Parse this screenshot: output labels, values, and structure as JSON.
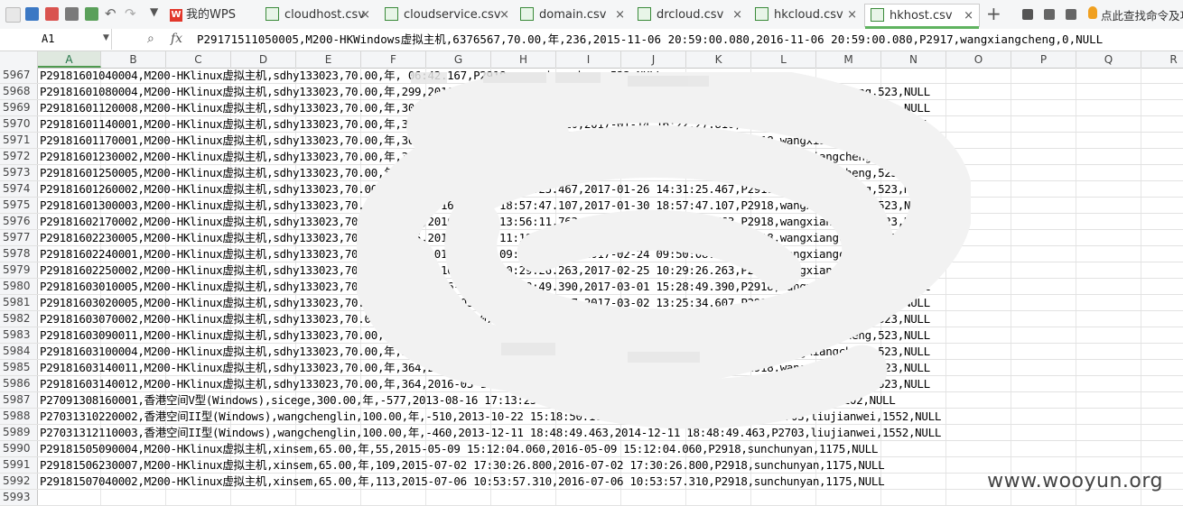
{
  "tabs": [
    {
      "label": "我的WPS",
      "kind": "wps"
    },
    {
      "label": "cloudhost.csv",
      "kind": "csv"
    },
    {
      "label": "cloudservice.csv",
      "kind": "csv"
    },
    {
      "label": "domain.csv",
      "kind": "csv"
    },
    {
      "label": "drcloud.csv",
      "kind": "csv"
    },
    {
      "label": "hkcloud.csv",
      "kind": "csv"
    },
    {
      "label": "hkhost.csv",
      "kind": "csv",
      "active": true
    }
  ],
  "toolbar": {
    "new_tab": "+",
    "search_hint": "点此查找命令及功"
  },
  "formula_bar": {
    "cell_ref": "A1",
    "fx": "fx",
    "value": "P29171511050005,M200-HKWindows虚拟主机,6376567,70.00,年,236,2015-11-06 20:59:00.080,2016-11-06 20:59:00.080,P2917,wangxiangcheng,0,NULL"
  },
  "columns": [
    "A",
    "B",
    "C",
    "D",
    "E",
    "F",
    "G",
    "H",
    "I",
    "J",
    "K",
    "L",
    "M",
    "N",
    "O",
    "P",
    "Q",
    "R"
  ],
  "rows": [
    {
      "num": "5967",
      "text": "P29181601040004,M200-HKlinux虚拟主机,sdhy133023,70.00,年,                           06:42.167,P2918,wangxiangcheng,523,NULL"
    },
    {
      "num": "5968",
      "text": "P29181601080004,M200-HKlinux虚拟主机,sdhy133023,70.00,年,299,2016-01-08 17:20:18.780,2017-01-08 17:20:18.780,P2918,wangxiangcheng,523,NULL"
    },
    {
      "num": "5969",
      "text": "P29181601120008,M200-HKlinux虚拟主机,sdhy133023,70.00,年,303,2016-01-12 14:31:39.123,2017-01-12 14:31:39.123,P2918,wangxiangcheng,523,NULL"
    },
    {
      "num": "5970",
      "text": "P29181601140001,M200-HKlinux虚拟主机,sdhy133023,70.00,年,305,2016-01-14 16:22:27.810,2017-01-14 16:22:27.810,P2918,wangxiangcheng,523,NULL"
    },
    {
      "num": "5971",
      "text": "P29181601170001,M200-HKlinux虚拟主机,sdhy133023,70.00,年,308,2016-01-17 10:35:12.513,2017-01-17 10:35:12.513,P2918,wangxiangcheng,523,NULL"
    },
    {
      "num": "5972",
      "text": "P29181601230002,M200-HKlinux虚拟主机,sdhy133023,70.00,年,314,2016-01-23 12:03:55.403,2017-01-23 12:03:55.403,P2918,wangxiangcheng,523,NULL"
    },
    {
      "num": "5973",
      "text": "P29181601250005,M200-HKlinux虚拟主机,sdhy133023,70.00,年,316,2016-01-25 11:38:02.110,2017-01-25 11:38:02.110,P2918,wangxiangcheng,523,NULL"
    },
    {
      "num": "5974",
      "text": "P29181601260002,M200-HKlinux虚拟主机,sdhy133023,70.00,年,317,2016-01-26 14:31:25.467,2017-01-26 14:31:25.467,P2918,wangxiangcheng,523,NULL"
    },
    {
      "num": "5975",
      "text": "P29181601300003,M200-HKlinux虚拟主机,sdhy133023,70.00,年,321,2016-01-30 18:57:47.107,2017-01-30 18:57:47.107,P2918,wangxiangcheng,523,NULL"
    },
    {
      "num": "5976",
      "text": "P29181602170002,M200-HKlinux虚拟主机,sdhy133023,70.00,年,339,2016-02-17 13:56:11.763,2017-02-17 13:56:11.763,P2918,wangxiangcheng,523,NULL"
    },
    {
      "num": "5977",
      "text": "P29181602230005,M200-HKlinux虚拟主机,sdhy133023,70.00,年,345,2016-02-23 11:19:37.513,2017-02-23 11:19:37.513,P2918,wangxiangcheng,523,NULL"
    },
    {
      "num": "5978",
      "text": "P29181602240001,M200-HKlinux虚拟主机,sdhy133023,70.00,年,346,2016-02-24 09:50:08.623,2017-02-24 09:50:08.623,P2918,wangxiangcheng,523,NULL"
    },
    {
      "num": "5979",
      "text": "P29181602250002,M200-HKlinux虚拟主机,sdhy133023,70.00,年,347,2016-02-25 10:29:26.263,2017-02-25 10:29:26.263,P2918,wangxiangcheng,523,NULL"
    },
    {
      "num": "5980",
      "text": "P29181603010005,M200-HKlinux虚拟主机,sdhy133023,70.00,年,351,2016-03-01 15:28:49.390,2017-03-01 15:28:49.390,P2918,wangxiangcheng,523,NULL"
    },
    {
      "num": "5981",
      "text": "P29181603020005,M200-HKlinux虚拟主机,sdhy133023,70.00,年,352,2016-03-02 13:25:34.607,2017-03-02 13:25:34.607,P2918,wangxiangcheng,523,NULL"
    },
    {
      "num": "5982",
      "text": "P29181603070002,M200-HKlinux虚拟主机,sdhy133023,70.00,年,357,2016-03-07 14:10:34.977,2017-03-07 14:10:34.977,P2918,wangxiangcheng,523,NULL"
    },
    {
      "num": "5983",
      "text": "P29181603090011,M200-HKlinux虚拟主机,sdhy133023,70.00,年,359,2016-03-09 16:03:04.423,2017-03-09 16:03:04.423,P2918,wangxiangcheng,523,NULL"
    },
    {
      "num": "5984",
      "text": "P29181603100004,M200-HKlinux虚拟主机,sdhy133023,70.00,年,360,2016-03-10 09:21:48.117,2017-03-10 09:21:48.117,P2918,wangxiangcheng,523,NULL"
    },
    {
      "num": "5985",
      "text": "P29181603140011,M200-HKlinux虚拟主机,sdhy133023,70.00,年,364,2016-03-14 17:12:41.697,2017-03-14 17:12:41.697,P2918,wangxiangcheng,523,NULL"
    },
    {
      "num": "5986",
      "text": "P29181603140012,M200-HKlinux虚拟主机,sdhy133023,70.00,年,364,2016-03-14 17:14:58.633,2017-03-14 17:14:58.633,P2918,wangxiangcheng,523,NULL"
    },
    {
      "num": "5987",
      "text": "P27091308160001,香港空间V型(Windows),sicege,300.00,年,-577,2013-08-16 17:13:25.937,2014-08-16 17:13:25.937,P2709,liujianwei,9102,NULL"
    },
    {
      "num": "5988",
      "text": "P27031310220002,香港空间II型(Windows),wangchenglin,100.00,年,-510,2013-10-22 15:18:50.163,2014-10-22 15:18:50.163,P2703,liujianwei,1552,NULL"
    },
    {
      "num": "5989",
      "text": "P27031312110003,香港空间II型(Windows),wangchenglin,100.00,年,-460,2013-12-11 18:48:49.463,2014-12-11 18:48:49.463,P2703,liujianwei,1552,NULL"
    },
    {
      "num": "5990",
      "text": "P29181505090004,M200-HKlinux虚拟主机,xinsem,65.00,年,55,2015-05-09 15:12:04.060,2016-05-09 15:12:04.060,P2918,sunchunyan,1175,NULL"
    },
    {
      "num": "5991",
      "text": "P29181506230007,M200-HKlinux虚拟主机,xinsem,65.00,年,109,2015-07-02 17:30:26.800,2016-07-02 17:30:26.800,P2918,sunchunyan,1175,NULL"
    },
    {
      "num": "5992",
      "text": "P29181507040002,M200-HKlinux虚拟主机,xinsem,65.00,年,113,2015-07-06 10:53:57.310,2016-07-06 10:53:57.310,P2918,sunchunyan,1175,NULL"
    },
    {
      "num": "5993",
      "text": ""
    }
  ],
  "watermark": "www.wooyun.org"
}
